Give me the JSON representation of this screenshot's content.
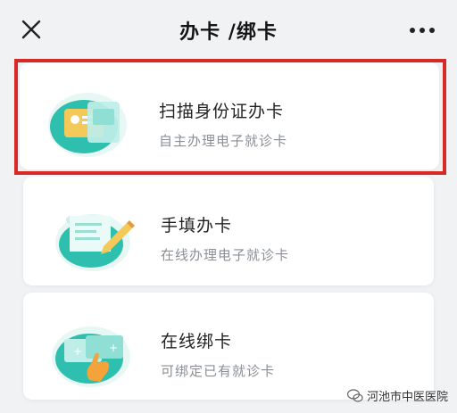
{
  "header": {
    "title": "办卡 /绑卡"
  },
  "cards": [
    {
      "title": "扫描身份证办卡",
      "subtitle": "自主办理电子就诊卡",
      "icon": "id-card-scan-icon",
      "highlighted": true
    },
    {
      "title": "手填办卡",
      "subtitle": "在线办理电子就诊卡",
      "icon": "form-pen-icon",
      "highlighted": false
    },
    {
      "title": "在线绑卡",
      "subtitle": "可绑定已有就诊卡",
      "icon": "card-bind-hand-icon",
      "highlighted": false
    }
  ],
  "watermark": {
    "text": "河池市中医医院"
  },
  "colors": {
    "accent": "#2fbfae",
    "highlight_border": "#d72a27",
    "background": "#f1f2f4"
  }
}
